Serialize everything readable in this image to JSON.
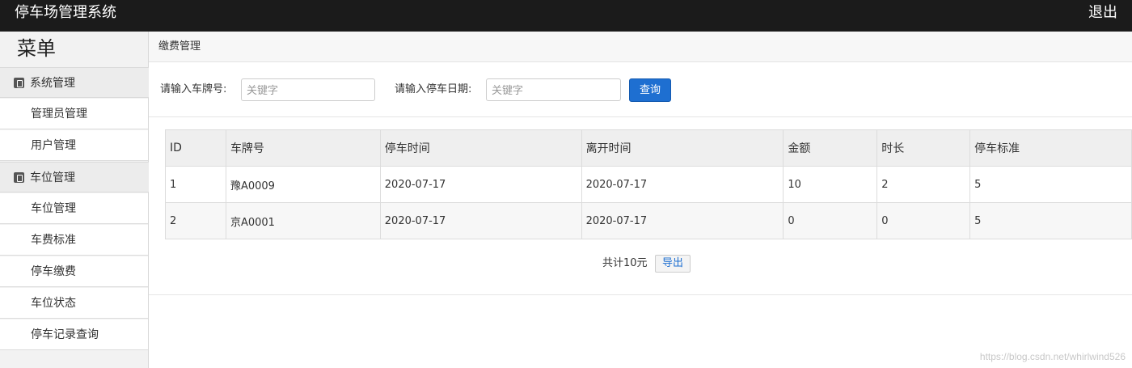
{
  "header": {
    "title": "停车场管理系统",
    "logout_label": "退出"
  },
  "sidebar": {
    "menu_title": "菜单",
    "groups": [
      {
        "label": "系统管理",
        "items": [
          "管理员管理",
          "用户管理"
        ]
      },
      {
        "label": "车位管理",
        "items": [
          "车位管理",
          "车费标准",
          "停车缴费",
          "车位状态",
          "停车记录查询"
        ]
      }
    ]
  },
  "breadcrumb": {
    "label": "缴费管理"
  },
  "search": {
    "plate_label": "请输入车牌号:",
    "plate_placeholder": "关键字",
    "date_label": "请输入停车日期:",
    "date_placeholder": "关键字",
    "query_label": "查询"
  },
  "table": {
    "columns": [
      "ID",
      "车牌号",
      "停车时间",
      "离开时间",
      "金额",
      "时长",
      "停车标准"
    ],
    "rows": [
      [
        "1",
        "豫A0009",
        "2020-07-17",
        "2020-07-17",
        "10",
        "2",
        "5"
      ],
      [
        "2",
        "京A0001",
        "2020-07-17",
        "2020-07-17",
        "0",
        "0",
        "5"
      ]
    ]
  },
  "footer": {
    "total_label": "共计10元",
    "export_label": "导出"
  },
  "watermark": "https://blog.csdn.net/whirlwind526"
}
